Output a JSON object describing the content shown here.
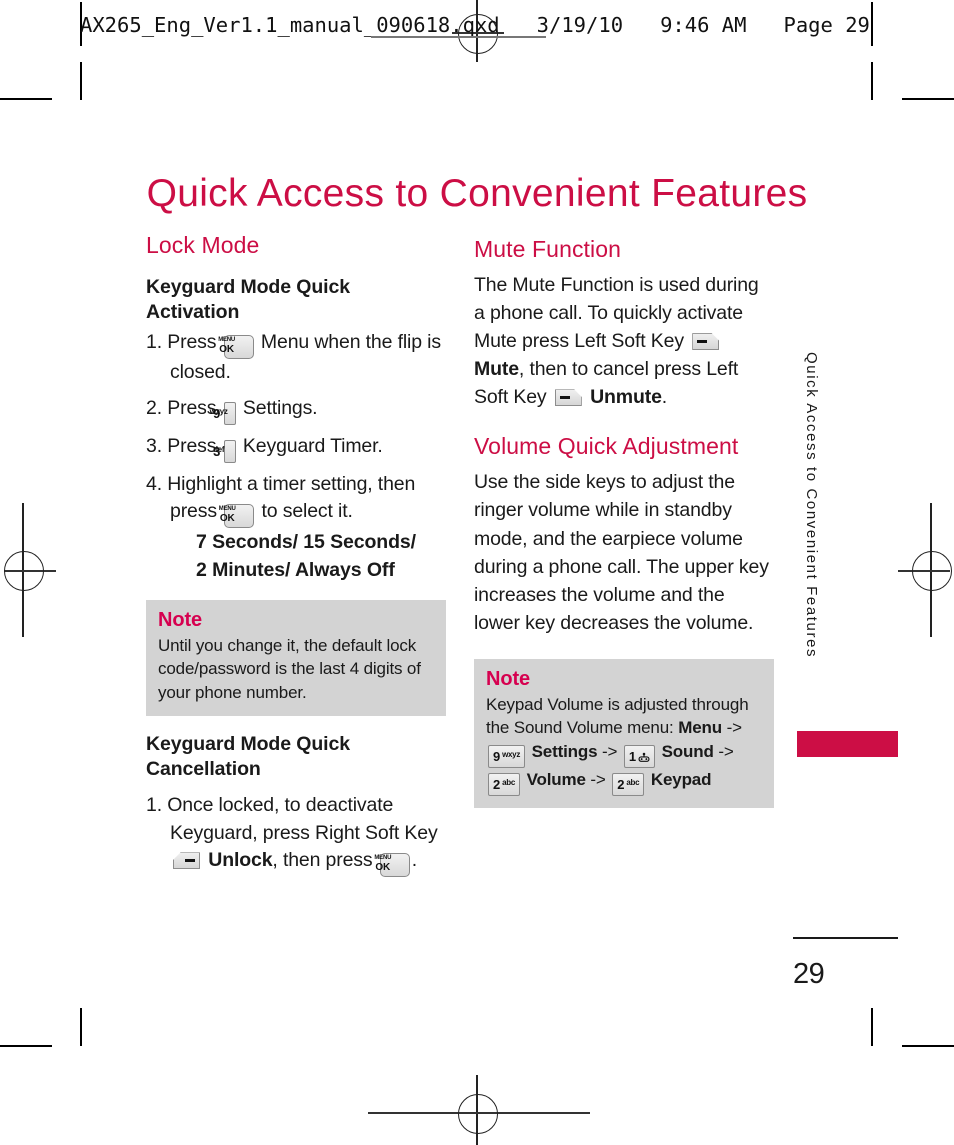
{
  "slug": {
    "text": "AX265_Eng_Ver1.1_manual_090618.qxd   3/19/10   9:46 AM   Page 29"
  },
  "page": {
    "title": "Quick Access to Convenient Features",
    "side_tab_text": "Quick Access to Convenient Features",
    "folio": "29",
    "accent_color": "#cc0e45",
    "note_bg_color": "#d3d3d3"
  },
  "left_column": {
    "section_title": "Lock Mode",
    "sub1": "Keyguard Mode Quick Activation",
    "steps1": [
      {
        "num": "1.",
        "before": "Press",
        "key": "menu-ok",
        "after": "Menu when the flip is closed."
      },
      {
        "num": "2.",
        "before": "Press",
        "key": "9-wxyz",
        "after": "Settings."
      },
      {
        "num": "3.",
        "before": "Press",
        "key": "3-def",
        "after": "Keyguard Timer."
      },
      {
        "num": "4.",
        "before": "Highlight a timer setting, then press",
        "key": "menu-ok",
        "after": "to select it."
      }
    ],
    "emphasis_line1": "7 Seconds/ 15 Seconds/",
    "emphasis_line2": "2 Minutes/ Always Off",
    "note": {
      "title": "Note",
      "body": "Until you change it, the default lock code/password is the last 4 digits of your phone number."
    },
    "sub2": "Keyguard Mode Quick Cancellation",
    "steps2": [
      {
        "num": "1.",
        "part1": "Once locked, to deactivate Keyguard, press Right Soft Key",
        "key1": "right-soft-key",
        "bold1": "Unlock",
        "part2": ", then press",
        "key2": "menu-ok",
        "part3": "."
      }
    ]
  },
  "right_column": {
    "section1_title": "Mute Function",
    "section1_body_a": "The Mute Function is used during a phone call. To quickly activate Mute press Left Soft Key",
    "section1_key1": "left-soft-key",
    "section1_bold1": "Mute",
    "section1_body_b": ", then to cancel press Left Soft Key",
    "section1_key2": "left-soft-key",
    "section1_bold2": "Unmute",
    "section1_body_c": ".",
    "section2_title": "Volume Quick Adjustment",
    "section2_body": "Use the side keys to adjust the ringer volume while in standby mode, and the earpiece volume during a phone call. The upper key increases the volume and the lower key decreases the volume.",
    "note": {
      "title": "Note",
      "line1": "Keypad Volume is adjusted",
      "line2": "through the Sound Volume menu:",
      "path": {
        "menu": "Menu",
        "arrow1": "->",
        "key1": "9-wxyz",
        "settings": "Settings",
        "arrow2": "->",
        "key2": "1-voicemail",
        "sound": "Sound",
        "arrow3": "->",
        "key3": "2-abc",
        "volume": "Volume",
        "arrow4": "->",
        "key4": "2-abc",
        "keypad": "Keypad"
      }
    }
  },
  "keys": {
    "menu-ok": {
      "line1": "MENU",
      "line2": "OK"
    },
    "9-wxyz": {
      "digit": "9",
      "letters": "wxyz"
    },
    "3-def": {
      "digit": "3",
      "letters": "def"
    },
    "2-abc": {
      "digit": "2",
      "letters": "abc"
    },
    "1-voicemail": {
      "digit": "1",
      "letters": ""
    }
  }
}
